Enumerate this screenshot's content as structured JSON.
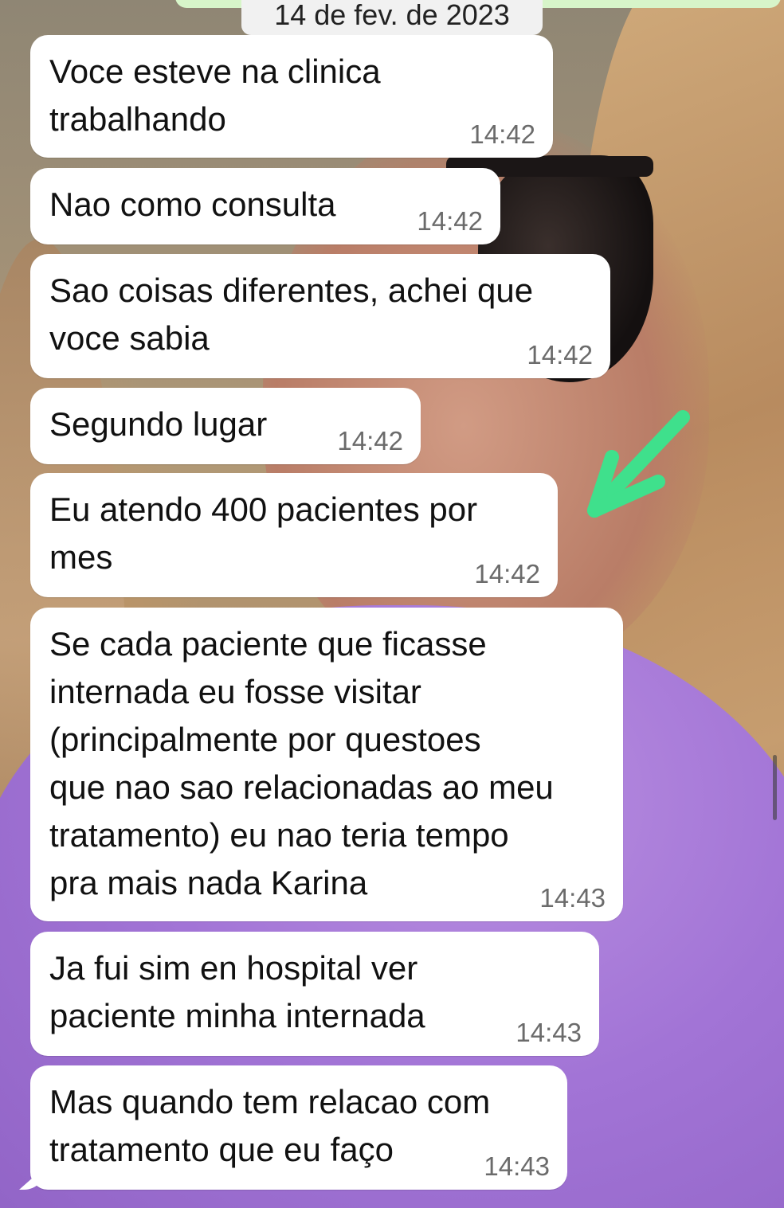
{
  "chat": {
    "date_label": "14 de fev. de 2023",
    "messages": [
      {
        "text": "Voce esteve na clinica\ntrabalhando",
        "time": "14:42"
      },
      {
        "text": "Nao como consulta",
        "time": "14:42"
      },
      {
        "text": "Sao coisas diferentes, achei que\nvoce sabia",
        "time": "14:42"
      },
      {
        "text": "Segundo lugar",
        "time": "14:42"
      },
      {
        "text": "Eu atendo 400 pacientes por\nmes",
        "time": "14:42"
      },
      {
        "text": "Se cada paciente que ficasse\ninternada eu fosse visitar\n(principalmente por questoes\nque nao sao relacionadas ao meu\ntratamento) eu nao teria tempo\npra mais nada Karina",
        "time": "14:43"
      },
      {
        "text": "Ja fui sim en hospital ver\npaciente minha internada",
        "time": "14:43"
      },
      {
        "text": "Mas quando tem relacao com\ntratamento que eu faço",
        "time": "14:43"
      }
    ]
  },
  "annotation": {
    "arrow_color": "#3fe08c",
    "icon": "arrow-down-left-icon"
  },
  "colors": {
    "bubble": "#ffffff",
    "date_chip": "#f1f1f1",
    "time_text": "#6b6b6b"
  }
}
